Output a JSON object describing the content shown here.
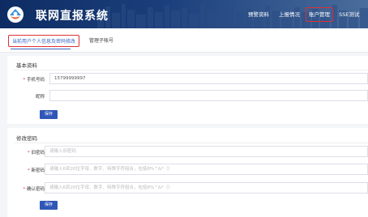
{
  "header": {
    "title": "联网直报系统",
    "nav": [
      "预警资料",
      "上报情况",
      "账户管理",
      "SSE测试"
    ],
    "active_nav": "账户管理"
  },
  "tabs": {
    "items": [
      "当前用户个人信息及密码修改",
      "管理子帐号"
    ],
    "active": "当前用户个人信息及密码修改"
  },
  "basic_info": {
    "title": "基本资料",
    "phone_label": "手机号码",
    "phone_value": "15799999997",
    "nickname_label": "昵称",
    "nickname_value": "",
    "save_label": "保存"
  },
  "password": {
    "title": "修改密码",
    "old_label": "旧密码",
    "old_placeholder": "请输入旧密码",
    "new_label": "新密码",
    "new_placeholder": "请输入6到20位字母、数字、特殊字符组合，包括8%^&*（）",
    "confirm_label": "确认密码",
    "confirm_placeholder": "请输入6到20位字母、数字、特殊字符组合，包括8%^&*（）",
    "save_label": "保存"
  }
}
